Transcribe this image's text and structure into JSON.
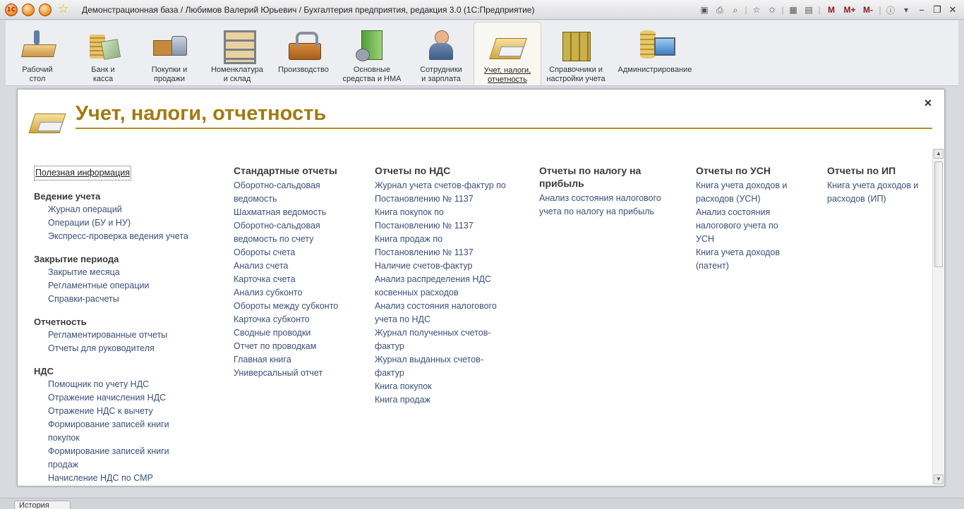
{
  "titlebar": {
    "title": "Демонстрационная база / Любимов Валерий Юрьевич / Бухгалтерия предприятия, редакция 3.0  (1С:Предприятие)",
    "m_label": "M",
    "mplus_label": "M+",
    "mminus_label": "M-"
  },
  "sections": [
    {
      "label": "Рабочий\nстол",
      "icon": "desktop-icon"
    },
    {
      "label": "Банк и\nкасса",
      "icon": "bank-icon"
    },
    {
      "label": "Покупки и\nпродажи",
      "icon": "truck-icon"
    },
    {
      "label": "Номенклатура\nи склад",
      "icon": "warehouse-icon"
    },
    {
      "label": "Производство",
      "icon": "tools-icon"
    },
    {
      "label": "Основные\nсредства и НМА",
      "icon": "assets-icon"
    },
    {
      "label": "Сотрудники\nи зарплата",
      "icon": "staff-icon"
    },
    {
      "label": "Учет, налоги,\nотчетность",
      "icon": "tax-icon"
    },
    {
      "label": "Справочники и\nнастройки учета",
      "icon": "books-icon"
    },
    {
      "label": "Администрирование",
      "icon": "admin-icon"
    }
  ],
  "form": {
    "title": "Учет, налоги, отчетность",
    "close": "×"
  },
  "col1": {
    "useful": "Полезная информация",
    "g1": "Ведение учета",
    "g1_items": [
      "Журнал операций",
      "Операции (БУ и НУ)",
      "Экспресс-проверка ведения учета"
    ],
    "g2": "Закрытие периода",
    "g2_items": [
      "Закрытие месяца",
      "Регламентные операции",
      "Справки-расчеты"
    ],
    "g3": "Отчетность",
    "g3_items": [
      "Регламентированные отчеты",
      "Отчеты для руководителя"
    ],
    "g4": "НДС",
    "g4_items": [
      "Помощник по учету НДС",
      "Отражение начисления НДС",
      "Отражение НДС к вычету",
      "Формирование записей книги покупок",
      "Формирование записей книги продаж",
      "Начисление НДС по СМР"
    ]
  },
  "col2": {
    "heading": "Стандартные отчеты",
    "items": [
      "Оборотно-сальдовая ведомость",
      "Шахматная ведомость",
      "Оборотно-сальдовая ведомость по счету",
      "Обороты счета",
      "Анализ счета",
      "Карточка счета",
      "Анализ субконто",
      "Обороты между субконто",
      "Карточка субконто",
      "Сводные проводки",
      "Отчет по проводкам",
      "Главная книга",
      "Универсальный отчет"
    ]
  },
  "col3": {
    "heading": "Отчеты по НДС",
    "items": [
      "Журнал учета счетов-фактур по Постановлению № 1137",
      "Книга покупок по Постановлению № 1137",
      "Книга продаж по Постановлению № 1137",
      "Наличие счетов-фактур",
      "Анализ распределения НДС косвенных расходов",
      "Анализ состояния налогового учета по НДС",
      "Журнал полученных счетов-фактур",
      "Журнал выданных счетов-фактур",
      "Книга покупок",
      "Книга продаж"
    ]
  },
  "col4": {
    "heading": "Отчеты по налогу на прибыль",
    "items": [
      "Анализ состояния налогового учета по налогу на прибыль"
    ]
  },
  "col5": {
    "heading": "Отчеты по УСН",
    "items": [
      "Книга учета доходов и расходов (УСН)",
      "Анализ состояния налогового учета по УСН",
      "Книга учета доходов (патент)"
    ]
  },
  "col6": {
    "heading": "Отчеты по ИП",
    "items": [
      "Книга учета доходов и расходов (ИП)"
    ]
  },
  "bottom": {
    "history_tab": "История"
  },
  "colors": {
    "title": "#a27a10",
    "link": "#3c4f7a",
    "accent_line": "#b68d1c"
  }
}
